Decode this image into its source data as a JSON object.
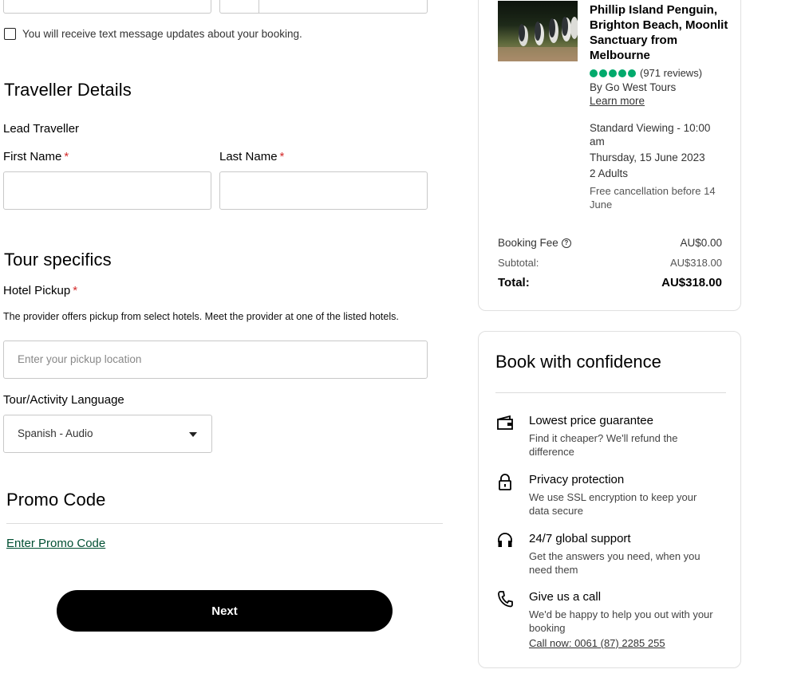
{
  "contact": {
    "sms_checkbox_label": "You will receive text message updates about your booking."
  },
  "traveller": {
    "heading": "Traveller Details",
    "lead_label": "Lead Traveller",
    "first_name_label": "First Name",
    "last_name_label": "Last Name",
    "first_name_value": "",
    "last_name_value": "",
    "required_mark": "*"
  },
  "tour": {
    "heading": "Tour specifics",
    "hotel_pickup_label": "Hotel Pickup",
    "hotel_pickup_note": "The provider offers pickup from select hotels. Meet the provider at one of the listed hotels.",
    "pickup_placeholder": "Enter your pickup location",
    "language_label": "Tour/Activity Language",
    "language_selected": "Spanish - Audio"
  },
  "promo": {
    "heading": "Promo Code",
    "link": "Enter Promo Code"
  },
  "next_button": "Next",
  "summary": {
    "title": "Phillip Island Penguin, Brighton Beach, Moonlit Sanctuary from Melbourne",
    "rating_value": 5,
    "reviews": "(971 reviews)",
    "operator": "By Go West Tours",
    "learn_more": "Learn more",
    "option": "Standard Viewing - 10:00 am",
    "date": "Thursday, 15 June 2023",
    "travellers": "2 Adults",
    "cancellation": "Free cancellation before 14 June",
    "booking_fee_label": "Booking Fee",
    "booking_fee_value": "AU$0.00",
    "subtotal_label": "Subtotal:",
    "subtotal_value": "AU$318.00",
    "total_label": "Total:",
    "total_value": "AU$318.00",
    "rating_color": "#00aa6c"
  },
  "confidence": {
    "heading": "Book with confidence",
    "items": [
      {
        "icon": "wallet-icon",
        "title": "Lowest price guarantee",
        "text": "Find it cheaper? We'll refund the difference"
      },
      {
        "icon": "lock-icon",
        "title": "Privacy protection",
        "text": "We use SSL encryption to keep your data secure"
      },
      {
        "icon": "headphones-icon",
        "title": "24/7 global support",
        "text": "Get the answers you need, when you need them"
      },
      {
        "icon": "phone-icon",
        "title": "Give us a call",
        "text": "We'd be happy to help you out with your booking"
      }
    ],
    "call_link": "Call now: 0061 (87) 2285 255"
  }
}
